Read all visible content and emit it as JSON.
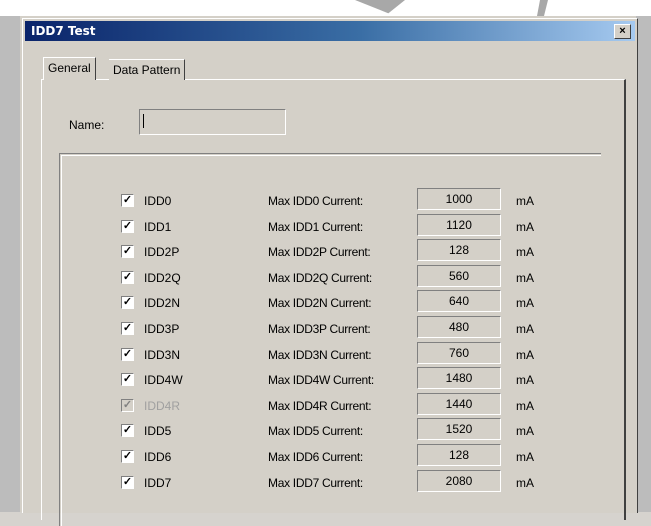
{
  "window": {
    "title": "IDD7 Test",
    "close_glyph": "×"
  },
  "tabs": [
    {
      "label": "General"
    },
    {
      "label": "Data Pattern"
    }
  ],
  "name_field": {
    "label": "Name:",
    "value": ""
  },
  "rows": [
    {
      "label": "IDD0",
      "max_label": "Max IDD0 Current:",
      "value": "1000",
      "unit": "mA",
      "checked": true,
      "disabled": false
    },
    {
      "label": "IDD1",
      "max_label": "Max IDD1 Current:",
      "value": "1120",
      "unit": "mA",
      "checked": true,
      "disabled": false
    },
    {
      "label": "IDD2P",
      "max_label": "Max IDD2P Current:",
      "value": "128",
      "unit": "mA",
      "checked": true,
      "disabled": false
    },
    {
      "label": "IDD2Q",
      "max_label": "Max IDD2Q Current:",
      "value": "560",
      "unit": "mA",
      "checked": true,
      "disabled": false
    },
    {
      "label": "IDD2N",
      "max_label": "Max IDD2N Current:",
      "value": "640",
      "unit": "mA",
      "checked": true,
      "disabled": false
    },
    {
      "label": "IDD3P",
      "max_label": "Max IDD3P Current:",
      "value": "480",
      "unit": "mA",
      "checked": true,
      "disabled": false
    },
    {
      "label": "IDD3N",
      "max_label": "Max IDD3N Current:",
      "value": "760",
      "unit": "mA",
      "checked": true,
      "disabled": false
    },
    {
      "label": "IDD4W",
      "max_label": "Max IDD4W Current:",
      "value": "1480",
      "unit": "mA",
      "checked": true,
      "disabled": false
    },
    {
      "label": "IDD4R",
      "max_label": "Max IDD4R Current:",
      "value": "1440",
      "unit": "mA",
      "checked": true,
      "disabled": true
    },
    {
      "label": "IDD5",
      "max_label": "Max IDD5 Current:",
      "value": "1520",
      "unit": "mA",
      "checked": true,
      "disabled": false
    },
    {
      "label": "IDD6",
      "max_label": "Max IDD6 Current:",
      "value": "128",
      "unit": "mA",
      "checked": true,
      "disabled": false
    },
    {
      "label": "IDD7",
      "max_label": "Max IDD7 Current:",
      "value": "2080",
      "unit": "mA",
      "checked": true,
      "disabled": false
    }
  ],
  "check_glyph": "✓",
  "colors": {
    "titlebar_start": "#0a246a",
    "titlebar_end": "#a6caf0",
    "face": "#d4d0c8"
  }
}
